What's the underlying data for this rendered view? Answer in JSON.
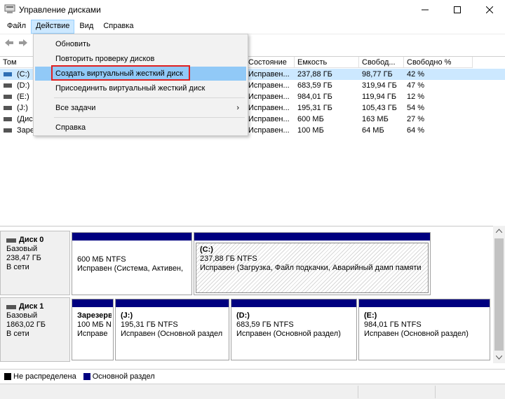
{
  "window": {
    "title": "Управление дисками"
  },
  "menubar": [
    {
      "label": "Файл"
    },
    {
      "label": "Действие"
    },
    {
      "label": "Вид"
    },
    {
      "label": "Справка"
    }
  ],
  "volume_table": {
    "columns": [
      "Том",
      "Состояние",
      "Емкость",
      "Свобод...",
      "Свободно %"
    ],
    "rows": [
      {
        "name": "(C:)",
        "status": "Исправен...",
        "capacity": "237,88 ГБ",
        "free": "98,77 ГБ",
        "free_pct": "42 %"
      },
      {
        "name": "(D:)",
        "status": "Исправен...",
        "capacity": "683,59 ГБ",
        "free": "319,94 ГБ",
        "free_pct": "47 %"
      },
      {
        "name": "(E:)",
        "status": "Исправен...",
        "capacity": "984,01 ГБ",
        "free": "119,94 ГБ",
        "free_pct": "12 %"
      },
      {
        "name": "(J:)",
        "status": "Исправен...",
        "capacity": "195,31 ГБ",
        "free": "105,43 ГБ",
        "free_pct": "54 %"
      },
      {
        "name": "(Дис",
        "status": "Исправен...",
        "capacity": "600 МБ",
        "free": "163 МБ",
        "free_pct": "27 %"
      },
      {
        "name": "Заре",
        "status": "Исправен...",
        "capacity": "100 МБ",
        "free": "64 МБ",
        "free_pct": "64 %"
      }
    ]
  },
  "action_menu": {
    "items": [
      {
        "label": "Обновить"
      },
      {
        "label": "Повторить проверку дисков"
      },
      {
        "label": "Создать виртуальный жесткий диск"
      },
      {
        "label": "Присоединить виртуальный жесткий диск"
      },
      {
        "label": "Все задачи",
        "arrow": "›"
      },
      {
        "label": "Справка"
      }
    ]
  },
  "disks": [
    {
      "name": "Диск 0",
      "type": "Базовый",
      "size": "238,47 ГБ",
      "state": "В сети",
      "partitions": [
        {
          "title": "",
          "line1": "600 МБ NTFS",
          "line2": "Исправен (Система, Активен,"
        },
        {
          "title": "(C:)",
          "line1": "237,88 ГБ NTFS",
          "line2": "Исправен (Загрузка, Файл подкачки, Аварийный дамп памяти"
        }
      ]
    },
    {
      "name": "Диск 1",
      "type": "Базовый",
      "size": "1863,02 ГБ",
      "state": "В сети",
      "partitions": [
        {
          "title": "Зарезерв",
          "line1": "100 МБ N",
          "line2": "Исправе"
        },
        {
          "title": "(J:)",
          "line1": "195,31 ГБ NTFS",
          "line2": "Исправен (Основной раздел"
        },
        {
          "title": "(D:)",
          "line1": "683,59 ГБ NTFS",
          "line2": "Исправен (Основной раздел)"
        },
        {
          "title": "(E:)",
          "line1": "984,01 ГБ NTFS",
          "line2": "Исправен (Основной раздел)"
        }
      ]
    }
  ],
  "legend": [
    {
      "label": "Не распределена",
      "color": "#000000"
    },
    {
      "label": "Основной раздел",
      "color": "#000080"
    }
  ],
  "colors": {
    "primary_partition": "#000080",
    "highlight": "#91c9f7",
    "red_outline": "#e02020"
  }
}
